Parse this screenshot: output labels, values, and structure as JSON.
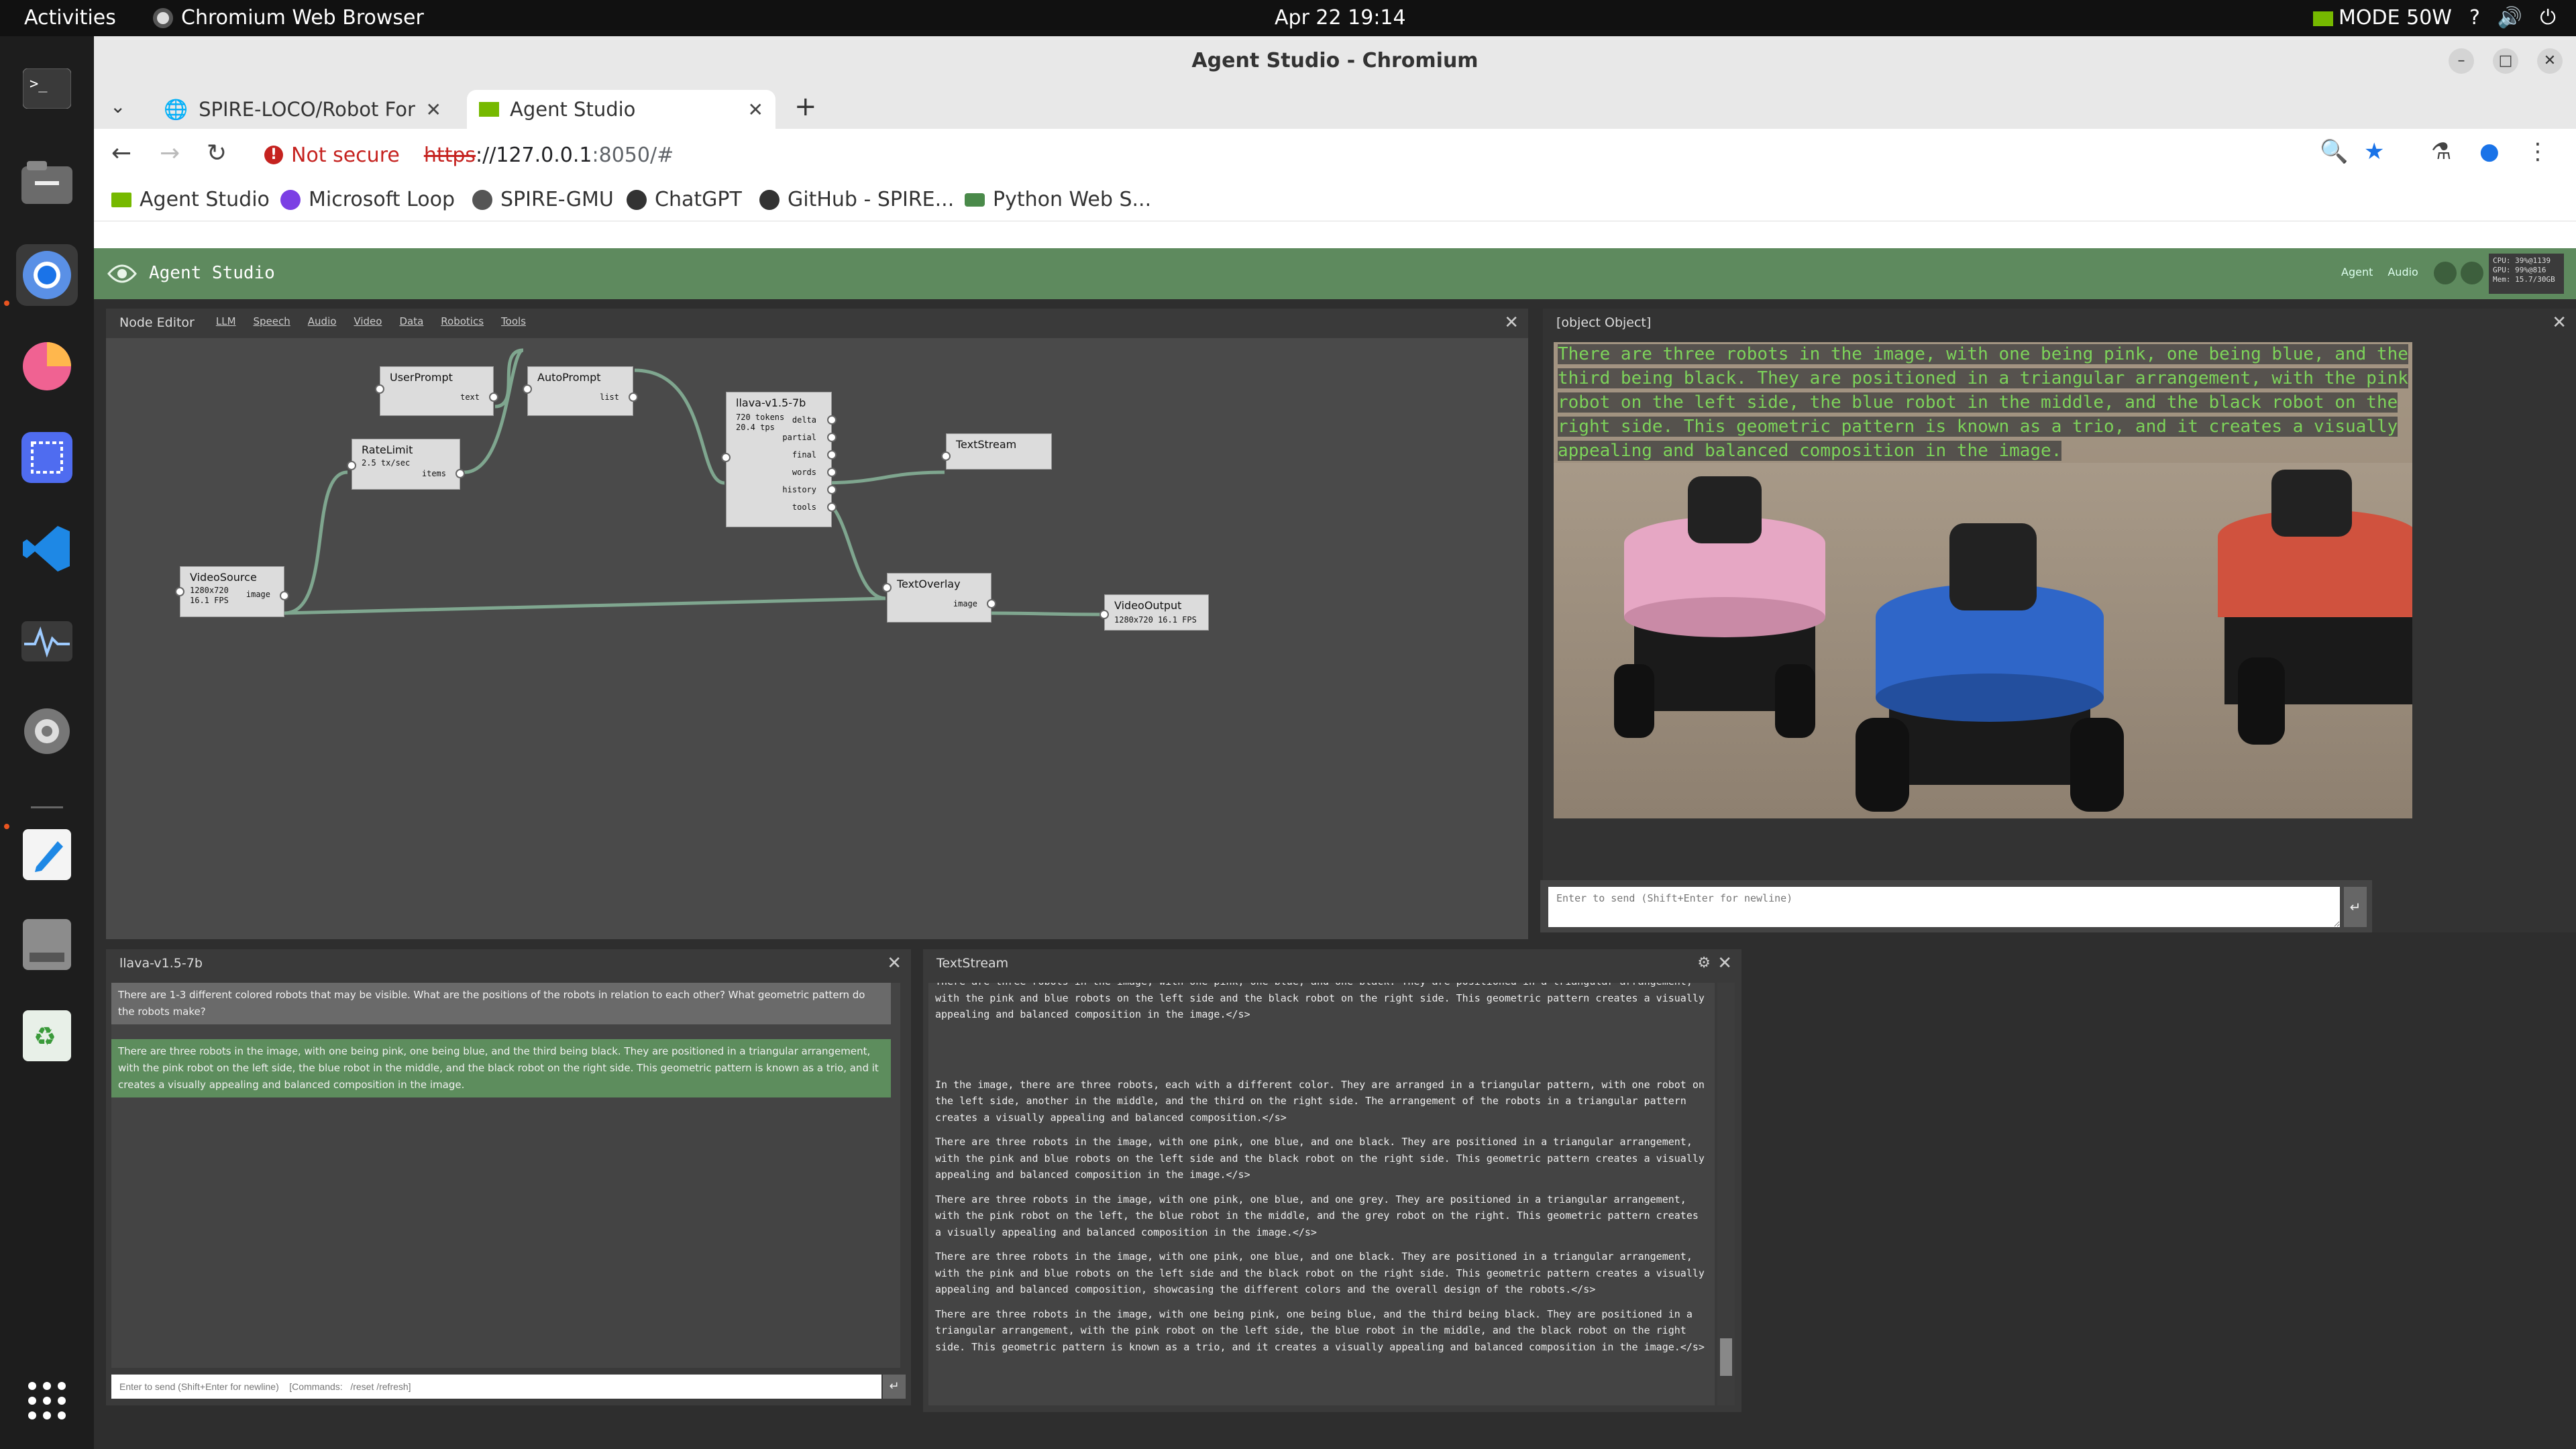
{
  "os": {
    "activities": "Activities",
    "app_name": "Chromium Web Browser",
    "clock": "Apr 22  19:14",
    "power_mode": "MODE 50W"
  },
  "window": {
    "title": "Agent Studio - Chromium"
  },
  "tabs": [
    {
      "title": "SPIRE-LOCO/Robot Form",
      "active": false
    },
    {
      "title": "Agent Studio",
      "active": true
    }
  ],
  "address": {
    "security": "Not secure",
    "scheme": "https",
    "host": "://127.0.0.1",
    "path": ":8050/#"
  },
  "bookmarks": [
    {
      "label": "Agent Studio",
      "color": "#76b900"
    },
    {
      "label": "Microsoft Loop",
      "color": "#7b3fe4"
    },
    {
      "label": "SPIRE-GMU",
      "color": "#555555"
    },
    {
      "label": "ChatGPT",
      "color": "#333333"
    },
    {
      "label": "GitHub - SPIRE...",
      "color": "#333333"
    },
    {
      "label": "Python Web S...",
      "color": "#4a8a4a"
    }
  ],
  "studio": {
    "brand": "Agent Studio",
    "nav_menu": [
      "Agent",
      "Audio"
    ],
    "stats": [
      "CPU: 39%@1139",
      "GPU: 99%@816",
      "Mem: 15.7/30GB"
    ]
  },
  "node_editor": {
    "title": "Node Editor",
    "menus": [
      "LLM",
      "Speech",
      "Audio",
      "Video",
      "Data",
      "Robotics",
      "Tools"
    ],
    "nodes": {
      "user_prompt": {
        "title": "UserPrompt",
        "port": "text"
      },
      "auto_prompt": {
        "title": "AutoPrompt",
        "port": "list"
      },
      "rate_limit": {
        "title": "RateLimit",
        "sub": "2.5 tx/sec",
        "port": "items"
      },
      "llava": {
        "title": "llava-v1.5-7b",
        "sub": "720 tokens\n20.4 tps",
        "ports": [
          "delta",
          "partial",
          "final",
          "words",
          "history",
          "tools"
        ]
      },
      "text_stream": {
        "title": "TextStream"
      },
      "video_source": {
        "title": "VideoSource",
        "sub": "1280x720\n16.1 FPS",
        "port": "image"
      },
      "text_overlay": {
        "title": "TextOverlay",
        "port": "image"
      },
      "video_output": {
        "title": "VideoOutput",
        "sub": "1280x720 16.1 FPS"
      }
    }
  },
  "video_panel": {
    "title": "[object Object]",
    "overlay_text": "There are three robots in the image, with one being pink, one being blue, and the third being black. They are positioned in a triangular arrangement, with the pink robot on the left side, the blue robot in the middle, and the black robot on the right side. This geometric pattern is known as a trio, and it creates a visually appealing and balanced composition in the image.",
    "input_placeholder": "Enter to send (Shift+Enter for newline)",
    "send_icon": "↵"
  },
  "chat_panel": {
    "title": "llava-v1.5-7b",
    "user_message": "There are 1-3 different colored robots that may be visible. What are the positions of the robots in relation to each other? What geometric pattern do the robots make?",
    "bot_message": "There are three robots in the image, with one being pink, one being blue, and the third being black. They are positioned in a triangular arrangement, with the pink robot on the left side, the blue robot in the middle, and the black robot on the right side. This geometric pattern is known as a trio, and it creates a visually appealing and balanced composition in the image.",
    "input_placeholder": "Enter to send (Shift+Enter for newline)    [Commands:   /reset /refresh]",
    "send_icon": "↵"
  },
  "text_stream_panel": {
    "title": "TextStream",
    "entries": [
      "There are three robots in the image, with one pink, one blue, and one black. They are positioned in a triangular arrangement, with the pink and blue robots on the left side and the black robot on the right side. This geometric pattern creates a visually appealing and balanced composition in the image.</s>",
      "",
      "In the image, there are three robots, each with a different color. They are arranged in a triangular pattern, with one robot on the left side, another in the middle, and the third on the right side. The arrangement of the robots in a triangular pattern creates a visually appealing and balanced composition.</s>",
      "There are three robots in the image, with one pink, one blue, and one black. They are positioned in a triangular arrangement, with the pink and blue robots on the left side and the black robot on the right side. This geometric pattern creates a visually appealing and balanced composition in the image.</s>",
      "There are three robots in the image, with one pink, one blue, and one grey. They are positioned in a triangular arrangement, with the pink robot on the left, the blue robot in the middle, and the grey robot on the right. This geometric pattern creates a visually appealing and balanced composition in the image.</s>",
      "There are three robots in the image, with one pink, one blue, and one black. They are positioned in a triangular arrangement, with the pink and blue robots on the left side and the black robot on the right side. This geometric pattern creates a visually appealing and balanced composition, showcasing the different colors and the overall design of the robots.</s>",
      "There are three robots in the image, with one being pink, one being blue, and the third being black. They are positioned in a triangular arrangement, with the pink robot on the left side, the blue robot in the middle, and the black robot on the right side. This geometric pattern is known as a trio, and it creates a visually appealing and balanced composition in the image.</s>"
    ]
  }
}
